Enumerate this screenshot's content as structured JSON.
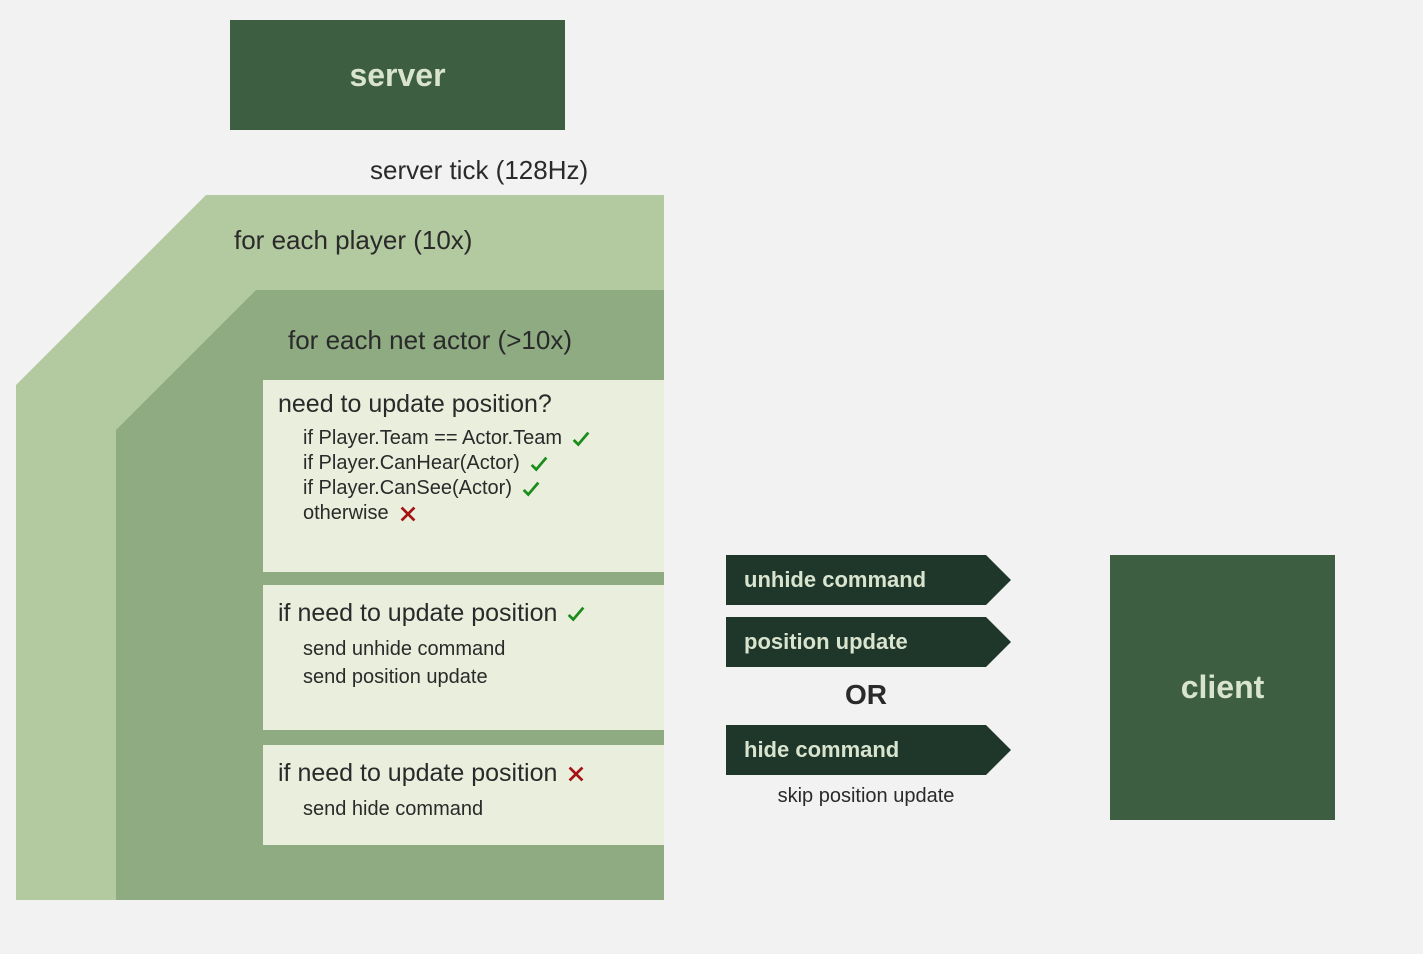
{
  "server": {
    "label": "server"
  },
  "server_tick": {
    "label": "server tick (128Hz)"
  },
  "outer_loop": {
    "label": "for each player (10x)"
  },
  "inner_loop": {
    "label": "for each net actor (>10x)"
  },
  "decision": {
    "title": "need to update position?",
    "conditions": {
      "team": "if Player.Team == Actor.Team",
      "hear": "if Player.CanHear(Actor)",
      "see": "if Player.CanSee(Actor)",
      "otherwise": "otherwise"
    }
  },
  "truthy": {
    "title": "if need to update position",
    "actions": {
      "unhide": "send unhide command",
      "position": "send position update"
    }
  },
  "falsy": {
    "title": "if need to update position",
    "actions": {
      "hide": "send hide command"
    }
  },
  "arrows": {
    "unhide": "unhide command",
    "position": "position update",
    "or": "OR",
    "hide": "hide command",
    "skip": "skip position update"
  },
  "client": {
    "label": "client"
  }
}
